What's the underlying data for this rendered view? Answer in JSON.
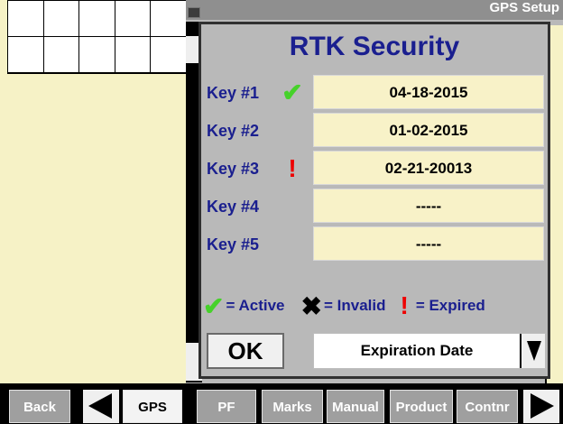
{
  "window": {
    "title": "GPS Setup"
  },
  "dialog": {
    "title": "RTK Security",
    "keys": [
      {
        "label": "Key #1",
        "status": "active",
        "date": "04-18-2015"
      },
      {
        "label": "Key #2",
        "status": "none",
        "date": "01-02-2015"
      },
      {
        "label": "Key #3",
        "status": "expired",
        "date": "02-21-20013"
      },
      {
        "label": "Key #4",
        "status": "none",
        "date": "-----"
      },
      {
        "label": "Key #5",
        "status": "none",
        "date": "-----"
      }
    ],
    "legend": {
      "active_label": "= Active",
      "invalid_label": "= Invalid",
      "expired_label": "= Expired"
    },
    "ok_label": "OK",
    "sort_select": {
      "selected": "Expiration Date"
    }
  },
  "bottom_tabs": [
    {
      "label": "Back"
    },
    {
      "label": "GPS",
      "active": true
    },
    {
      "label": "PF"
    },
    {
      "label": "Marks"
    },
    {
      "label": "Manual"
    },
    {
      "label": "Product"
    },
    {
      "label": "Contnr"
    }
  ],
  "colors": {
    "title_blue": "#1a1f8f",
    "check_green": "#46d22a",
    "expired_red": "#e00000",
    "field_cream": "#f8f2c8"
  }
}
